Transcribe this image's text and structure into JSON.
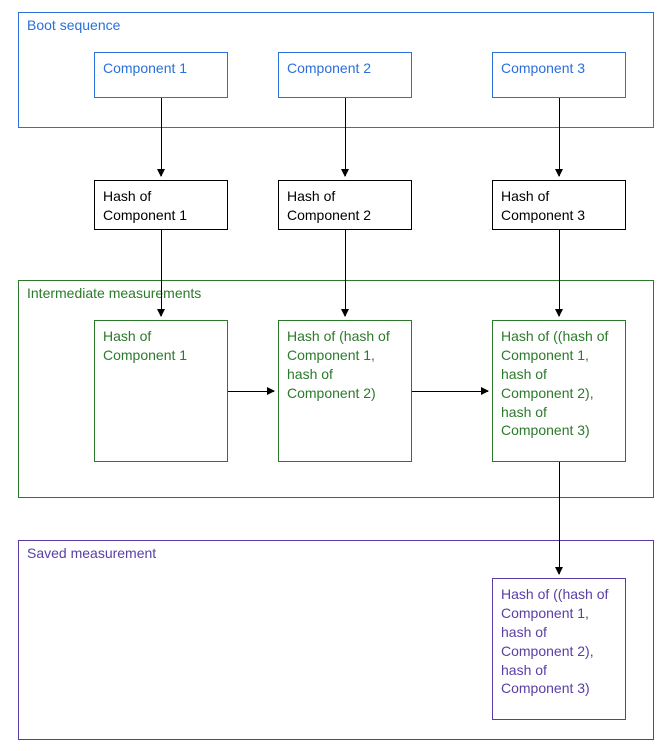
{
  "bootSequence": {
    "title": "Boot sequence",
    "components": [
      "Component 1",
      "Component 2",
      "Component 3"
    ]
  },
  "hashes": [
    "Hash of Component 1",
    "Hash of Component 2",
    "Hash of Component 3"
  ],
  "intermediate": {
    "title": "Intermediate measurements",
    "items": [
      "Hash of Component 1",
      "Hash of (hash of Component 1, hash of Component 2)",
      "Hash of ((hash of Component 1, hash of Component 2), hash of Component 3)"
    ]
  },
  "saved": {
    "title": "Saved measurement",
    "item": "Hash of ((hash of Component 1, hash of Component 2), hash of Component 3)"
  }
}
